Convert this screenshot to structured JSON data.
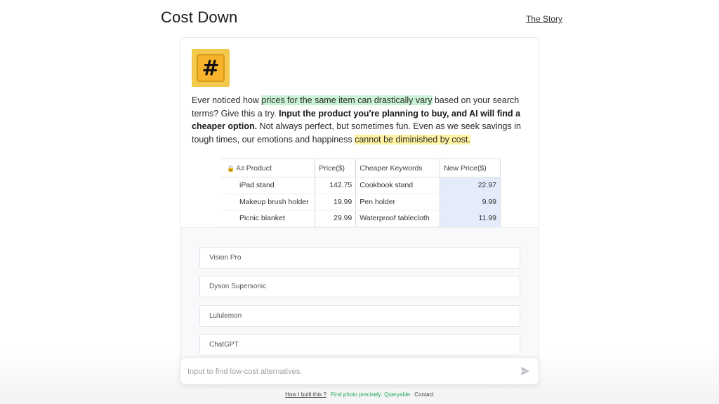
{
  "header": {
    "title": "Cost Down",
    "story_link": "The Story"
  },
  "card": {
    "icon": "hash-keycap-icon",
    "icon_glyph": "#",
    "intro": {
      "p1": "Ever noticed how ",
      "h1": "prices for the same item can drastically vary",
      "p2": " based on your search terms? Give this a try. ",
      "b1": "Input the product you're planning to buy, and AI will find a cheaper option.",
      "p3": " Not always perfect, but sometimes fun. Even as we seek savings in tough times, our emotions and happiness ",
      "h2": "cannot be diminished by cost."
    },
    "table": {
      "headers": [
        "Product",
        "Price($)",
        "Cheaper Keywords",
        "New Price($)"
      ],
      "rows": [
        [
          "iPad stand",
          "142.75",
          "Cookbook stand",
          "22.97"
        ],
        [
          "Makeup brush holder",
          "19.99",
          "Pen holder",
          "9.99"
        ],
        [
          "Picnic blanket",
          "29.99",
          "Waterproof tablecloth",
          "11.99"
        ]
      ]
    },
    "suggestions": [
      "Vision Pro",
      "Dyson Supersonic",
      "Lululemon",
      "ChatGPT"
    ]
  },
  "chat": {
    "placeholder": "Input to find low-cost alternatives.",
    "send_icon": "send-icon"
  },
  "footer": {
    "how_built": "How I built this ?",
    "queryable": "Find photo precisely: Queryable",
    "contact": "Contact"
  },
  "colors": {
    "highlight_green": "#c9f2d4",
    "highlight_yellow": "#fff3a3",
    "new_price_bg": "#e4ecfb",
    "footer_green": "#1faa59",
    "icon_yellow": "#f7b32b"
  }
}
